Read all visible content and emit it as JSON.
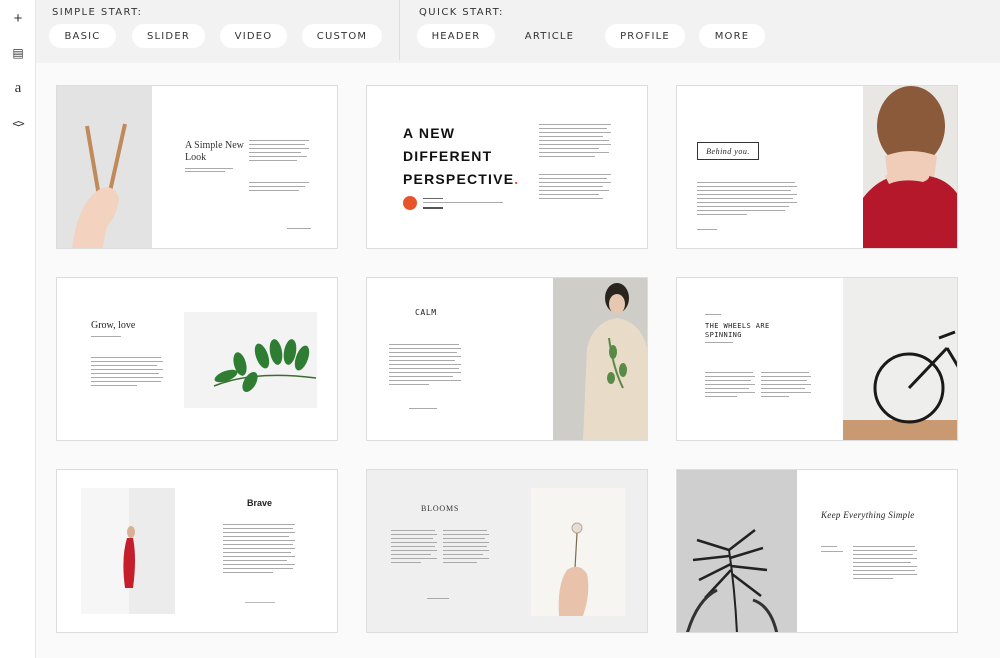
{
  "sidebar": {
    "add_glyph": "+",
    "doc_glyph": "▤",
    "text_glyph": "a",
    "code_glyph": "<>"
  },
  "simple_start": {
    "label": "SIMPLE START:",
    "buttons": [
      "BASIC",
      "SLIDER",
      "VIDEO",
      "CUSTOM"
    ]
  },
  "quick_start": {
    "label": "QUICK START:",
    "buttons": [
      "HEADER",
      "ARTICLE",
      "PROFILE",
      "MORE"
    ]
  },
  "templates": [
    {
      "title": "A Simple New Look"
    },
    {
      "title": "A NEW DIFFERENT PERSPECTIVE",
      "dot": "."
    },
    {
      "title": "Behind you."
    },
    {
      "title": "Grow, love"
    },
    {
      "title": "CALM"
    },
    {
      "title": "THE WHEELS ARE SPINNING"
    },
    {
      "title": "Brave"
    },
    {
      "title": "BLOOMS"
    },
    {
      "title": "Keep Everything Simple"
    }
  ],
  "colors": {
    "accent": "#e8542a",
    "red": "#b5182a",
    "leaf": "#2e7d32"
  }
}
